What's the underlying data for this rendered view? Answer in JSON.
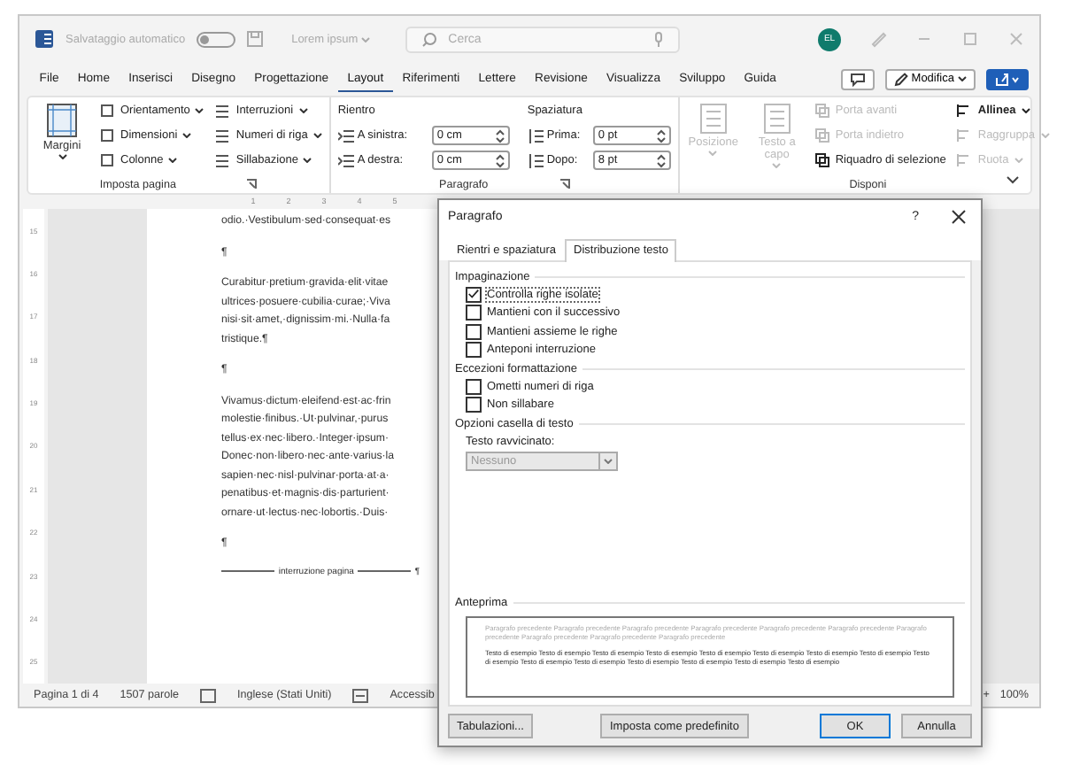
{
  "titlebar": {
    "autosave_label": "Salvataggio automatico",
    "autosave_on": false,
    "doc_title": "Lorem ipsum",
    "search_placeholder": "Cerca",
    "avatar": "EL"
  },
  "tabs": [
    {
      "label": "File",
      "selected": false
    },
    {
      "label": "Home",
      "selected": false
    },
    {
      "label": "Inserisci",
      "selected": false
    },
    {
      "label": "Disegno",
      "selected": false
    },
    {
      "label": "Progettazione",
      "selected": false
    },
    {
      "label": "Layout",
      "selected": true
    },
    {
      "label": "Riferimenti",
      "selected": false
    },
    {
      "label": "Lettere",
      "selected": false
    },
    {
      "label": "Revisione",
      "selected": false
    },
    {
      "label": "Visualizza",
      "selected": false
    },
    {
      "label": "Sviluppo",
      "selected": false
    },
    {
      "label": "Guida",
      "selected": false
    }
  ],
  "edit_button": "Modifica",
  "ribbon": {
    "page_setup": {
      "label": "Imposta pagina",
      "margins": "Margini",
      "col1": [
        "Orientamento",
        "Dimensioni",
        "Colonne"
      ],
      "col2": [
        "Interruzioni",
        "Numeri di riga",
        "Sillabazione"
      ]
    },
    "paragraph": {
      "label": "Paragrafo",
      "indent_title": "Rientro",
      "spacing_title": "Spaziatura",
      "indent": [
        {
          "label": "A sinistra:",
          "value": "0 cm"
        },
        {
          "label": "A destra:",
          "value": "0 cm"
        }
      ],
      "spacing": [
        {
          "label": "Prima:",
          "value": "0 pt"
        },
        {
          "label": "Dopo:",
          "value": "8 pt"
        }
      ]
    },
    "arrange": {
      "label": "Disponi",
      "big": [
        {
          "label": "Posizione",
          "disabled": true
        },
        {
          "label": "Testo a capo",
          "disabled": true
        }
      ],
      "col1": [
        {
          "label": "Porta avanti",
          "disabled": true
        },
        {
          "label": "Porta indietro",
          "disabled": true
        },
        {
          "label": "Riquadro di selezione",
          "disabled": false
        }
      ],
      "col2": [
        {
          "label": "Allinea",
          "disabled": false
        },
        {
          "label": "Raggruppa",
          "disabled": true
        },
        {
          "label": "Ruota",
          "disabled": true
        }
      ]
    }
  },
  "ruler": {
    "h": [
      "1",
      "2",
      "3",
      "4",
      "5"
    ],
    "v": [
      "15",
      "16",
      "17",
      "18",
      "19",
      "20",
      "21",
      "22",
      "23",
      "24",
      "25"
    ]
  },
  "document": [
    {
      "kind": "text",
      "lines": [
        "odio.·Vestibulum·sed·consequat·es"
      ]
    },
    {
      "kind": "mark",
      "text": "¶"
    },
    {
      "kind": "text",
      "lines": [
        "Curabitur·pretium·gravida·elit·vitae",
        "ultrices·posuere·cubilia·curae;·Viva",
        "nisi·sit·amet,·dignissim·mi.·Nulla·fa",
        "tristique.¶"
      ]
    },
    {
      "kind": "mark",
      "text": "¶"
    },
    {
      "kind": "text",
      "lines": [
        "Vivamus·dictum·eleifend·est·ac·frin",
        "molestie·finibus.·Ut·pulvinar,·purus",
        "tellus·ex·nec·libero.·Integer·ipsum·",
        "Donec·non·libero·nec·ante·varius·la",
        "sapien·nec·nisl·pulvinar·porta·at·a·",
        "penatibus·et·magnis·dis·parturient·",
        "ornare·ut·lectus·nec·lobortis.·Duis·"
      ]
    },
    {
      "kind": "mark",
      "text": "¶"
    },
    {
      "kind": "break",
      "text": "interruzione pagina",
      "end": "¶"
    }
  ],
  "status_bar": {
    "page": "Pagina 1 di 4",
    "words": "1507 parole",
    "language": "Inglese (Stati Uniti)",
    "accessibility": "Accessib",
    "zoom_in": "+",
    "zoom": "100%"
  },
  "dialog": {
    "title": "Paragrafo",
    "help": "?",
    "tabs": [
      {
        "label": "Rientri e spaziatura",
        "selected": false
      },
      {
        "label": "Distribuzione testo",
        "selected": true
      }
    ],
    "sections": [
      {
        "title": "Impaginazione",
        "options": [
          {
            "label": "Controlla righe isolate",
            "checked": true
          },
          {
            "label": "Mantieni con il successivo",
            "checked": false
          },
          {
            "label": "Mantieni assieme le righe",
            "checked": false
          },
          {
            "label": "Anteponi interruzione",
            "checked": false
          }
        ]
      },
      {
        "title": "Eccezioni formattazione",
        "options": [
          {
            "label": "Ometti numeri di riga",
            "checked": false
          },
          {
            "label": "Non sillabare",
            "checked": false
          }
        ]
      }
    ],
    "textbox_title": "Opzioni casella di testo",
    "tight_label": "Testo ravvicinato:",
    "tight_value": "Nessuno",
    "tight_disabled": true,
    "preview_title": "Anteprima",
    "preview_previous": "Paragrafo precedente Paragrafo precedente Paragrafo precedente Paragrafo precedente Paragrafo precedente Paragrafo precedente Paragrafo precedente Paragrafo precedente Paragrafo precedente Paragrafo precedente",
    "preview_sample": "Testo di esempio Testo di esempio Testo di esempio Testo di esempio Testo di esempio Testo di esempio Testo di esempio Testo di esempio Testo di esempio Testo di esempio Testo di esempio Testo di esempio Testo di esempio Testo di esempio Testo di esempio",
    "buttons": [
      {
        "label": "Tabulazioni...",
        "kind": "normal"
      },
      {
        "label": "Imposta come predefinito",
        "kind": "normal"
      },
      {
        "label": "OK",
        "kind": "default"
      },
      {
        "label": "Annulla",
        "kind": "normal"
      }
    ]
  }
}
